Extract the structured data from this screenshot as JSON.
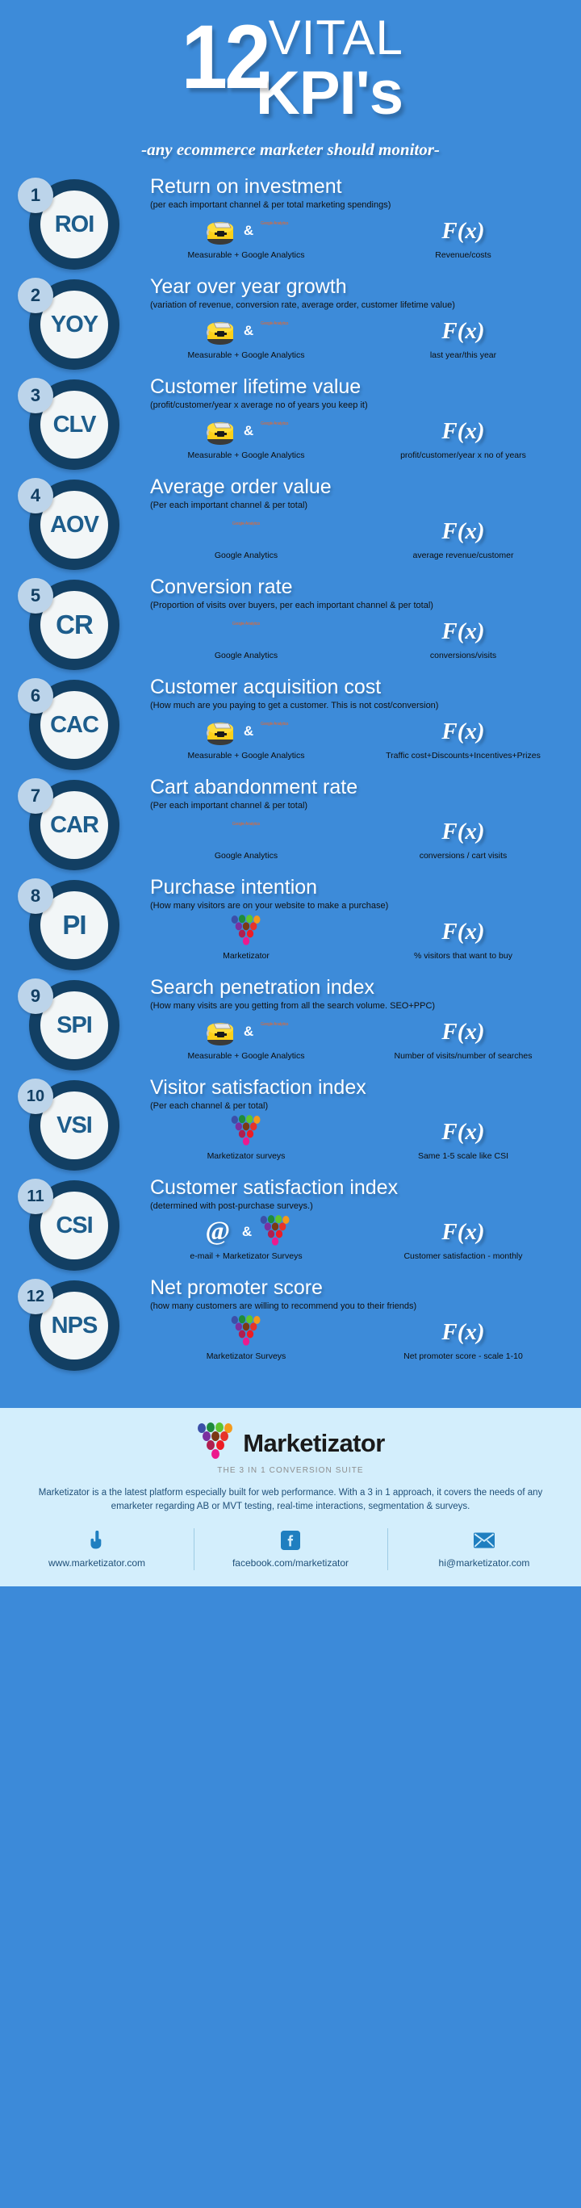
{
  "header": {
    "number": "12",
    "vital": "VITAL",
    "kpis": "KPI's",
    "subtitle": "-any ecommerce marketer should monitor-"
  },
  "colors": {
    "background": "#3d8bd9",
    "badge_ring": "#123f63",
    "badge_inner": "#f2f6f7",
    "badge_number_bg": "#bcd4ea",
    "abbr_text": "#1d5d8c",
    "footer_bg": "#d3eefc",
    "footer_text": "#1e4f78",
    "ga_orange": "#f5a623",
    "ga_red": "#e8402a"
  },
  "kpis": [
    {
      "number": "1",
      "abbr": "ROI",
      "title": "Return on investment",
      "subtitle": "(per each important channel & per total marketing spendings)",
      "tools": [
        "measurable-icon",
        "google-analytics-icon"
      ],
      "tools_caption": "Measurable + Google Analytics",
      "formula_symbol": "F(x)",
      "formula_caption": "Revenue/costs"
    },
    {
      "number": "2",
      "abbr": "YOY",
      "title": "Year over year growth",
      "subtitle": "(variation of revenue, conversion rate, average order, customer lifetime value)",
      "tools": [
        "measurable-icon",
        "google-analytics-icon"
      ],
      "tools_caption": "Measurable + Google Analytics",
      "formula_symbol": "F(x)",
      "formula_caption": "last year/this year"
    },
    {
      "number": "3",
      "abbr": "CLV",
      "title": "Customer lifetime value",
      "subtitle": "(profit/customer/year x average no of years you keep it)",
      "tools": [
        "measurable-icon",
        "google-analytics-icon"
      ],
      "tools_caption": "Measurable + Google Analytics",
      "formula_symbol": "F(x)",
      "formula_caption": "profit/customer/year x no of years"
    },
    {
      "number": "4",
      "abbr": "AOV",
      "title": "Average order value",
      "subtitle": "(Per each important channel & per total)",
      "tools": [
        "google-analytics-icon"
      ],
      "tools_caption": "Google Analytics",
      "formula_symbol": "F(x)",
      "formula_caption": "average revenue/customer"
    },
    {
      "number": "5",
      "abbr": "CR",
      "title": "Conversion rate",
      "subtitle": "(Proportion of visits over buyers, per each important channel & per total)",
      "tools": [
        "google-analytics-icon"
      ],
      "tools_caption": "Google Analytics",
      "formula_symbol": "F(x)",
      "formula_caption": "conversions/visits"
    },
    {
      "number": "6",
      "abbr": "CAC",
      "title": "Customer acquisition cost",
      "subtitle": "(How much are you paying to get a customer. This is not cost/conversion)",
      "tools": [
        "measurable-icon",
        "google-analytics-icon"
      ],
      "tools_caption": "Measurable + Google Analytics",
      "formula_symbol": "F(x)",
      "formula_caption": "Traffic cost+Discounts+Incentives+Prizes"
    },
    {
      "number": "7",
      "abbr": "CAR",
      "title": "Cart abandonment rate",
      "subtitle": "(Per each important channel & per total)",
      "tools": [
        "google-analytics-icon"
      ],
      "tools_caption": "Google Analytics",
      "formula_symbol": "F(x)",
      "formula_caption": "conversions / cart visits"
    },
    {
      "number": "8",
      "abbr": "PI",
      "title": "Purchase intention",
      "subtitle": "(How many visitors are on your website to make a purchase)",
      "tools": [
        "marketizator-icon"
      ],
      "tools_caption": "Marketizator",
      "formula_symbol": "F(x)",
      "formula_caption": "% visitors that want to buy"
    },
    {
      "number": "9",
      "abbr": "SPI",
      "title": "Search penetration index",
      "subtitle": "(How many visits are you getting from all the search volume. SEO+PPC)",
      "tools": [
        "measurable-icon",
        "google-analytics-icon"
      ],
      "tools_caption": "Measurable + Google Analytics",
      "formula_symbol": "F(x)",
      "formula_caption": "Number of visits/number of searches"
    },
    {
      "number": "10",
      "abbr": "VSI",
      "title": "Visitor satisfaction index",
      "subtitle": "(Per each channel & per total)",
      "tools": [
        "marketizator-icon"
      ],
      "tools_caption": "Marketizator surveys",
      "formula_symbol": "F(x)",
      "formula_caption": "Same 1-5 scale like CSI"
    },
    {
      "number": "11",
      "abbr": "CSI",
      "title": "Customer satisfaction index",
      "subtitle": "(determined with post-purchase surveys.)",
      "tools": [
        "at-sign-icon",
        "marketizator-icon"
      ],
      "tools_caption": "e-mail + Marketizator Surveys",
      "formula_symbol": "F(x)",
      "formula_caption": "Customer satisfaction - monthly"
    },
    {
      "number": "12",
      "abbr": "NPS",
      "title": "Net promoter score",
      "subtitle": "(how many customers are willing to recommend you to their friends)",
      "tools": [
        "marketizator-icon"
      ],
      "tools_caption": "Marketizator Surveys",
      "formula_symbol": "F(x)",
      "formula_caption": "Net promoter score - scale 1-10"
    }
  ],
  "footer": {
    "brand_name": "Marketizator",
    "brand_tagline": "THE 3 IN 1 CONVERSION SUITE",
    "description": "Marketizator is a the latest platform especially built for web performance. With a 3 in 1 approach, it covers the needs of any emarketer regarding AB or MVT testing, real-time interactions, segmentation & surveys.",
    "links": [
      {
        "icon": "pointing-hand-icon",
        "text": "www.marketizator.com"
      },
      {
        "icon": "facebook-icon",
        "text": "facebook.com/marketizator"
      },
      {
        "icon": "envelope-icon",
        "text": "hi@marketizator.com"
      }
    ]
  }
}
